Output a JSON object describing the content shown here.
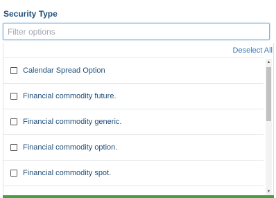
{
  "header": {
    "label": "Security Type"
  },
  "filter": {
    "placeholder": "Filter options",
    "value": ""
  },
  "actions": {
    "deselect_all": "Deselect All"
  },
  "options": [
    {
      "label": "Calendar Spread Option",
      "checked": false
    },
    {
      "label": "Financial commodity future.",
      "checked": false
    },
    {
      "label": "Financial commodity generic.",
      "checked": false
    },
    {
      "label": "Financial commodity option.",
      "checked": false
    },
    {
      "label": "Financial commodity spot.",
      "checked": false
    }
  ],
  "colors": {
    "accent": "#43a047",
    "label": "#1f4e79",
    "link": "#3a78b5"
  }
}
